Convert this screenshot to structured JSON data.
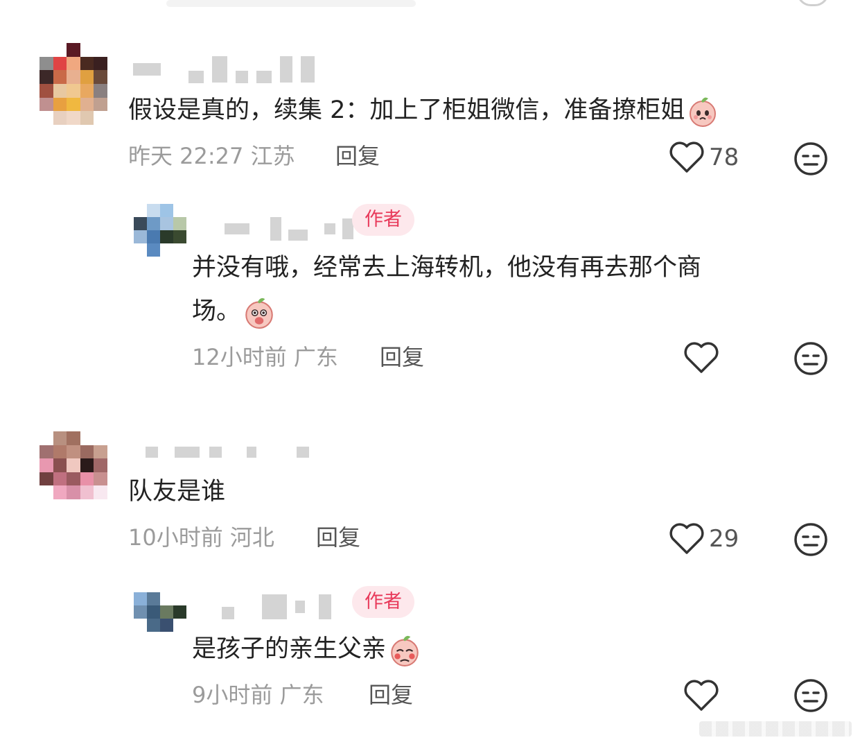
{
  "comments": [
    {
      "text": "假设是真的，续集 2：加上了柜姐微信，准备撩柜姐",
      "time": "昨天 22:27",
      "location": "江苏",
      "reply_label": "回复",
      "likes": "78",
      "avatar_colors": [
        "#ffffff",
        "#ffffff",
        "#5a1a24",
        "#ffffff",
        "#ffffff",
        "#8e8e8e",
        "#e04444",
        "#f0a880",
        "#4a2a20",
        "#3a2020",
        "#3c2828",
        "#c96a48",
        "#e8b090",
        "#e0a040",
        "#6a4a3a",
        "#a05040",
        "#e8c8a0",
        "#f0c890",
        "#e8a860",
        "#8a8080",
        "#c09090",
        "#e8a040",
        "#f0b840",
        "#e0b090",
        "#c0a090",
        "#ffffff",
        "#e8d0c0",
        "#f0d8c8",
        "#e0c8b0",
        "#ffffff"
      ],
      "reply": {
        "badge": "作者",
        "text_line1": "并没有哦，经常去上海转机，他没有再去那个商",
        "text_line2": "场。",
        "time": "12小时前",
        "location": "广东",
        "reply_label": "回复",
        "avatar_colors": [
          "#ffffff",
          "#c8dcef",
          "#9ec4e6",
          "#ffffff",
          "#3a4a5a",
          "#6e9ac6",
          "#a8c4e0",
          "#b8c8a8",
          "#9ab8d8",
          "#4a7ab0",
          "#2a3a2a",
          "#3a4a30",
          "#ffffff",
          "#5a8ac0",
          "#ffffff",
          "#ffffff"
        ]
      }
    },
    {
      "text": "队友是谁",
      "time": "10小时前",
      "location": "河北",
      "reply_label": "回复",
      "likes": "29",
      "avatar_colors": [
        "#ffffff",
        "#b89080",
        "#a07060",
        "#ffffff",
        "#ffffff",
        "#a07070",
        "#b07a6a",
        "#c09080",
        "#9a6a60",
        "#c8a090",
        "#e898b0",
        "#8a5050",
        "#f0c8c0",
        "#2a1a1a",
        "#a06868",
        "#704040",
        "#c07080",
        "#9a5a60",
        "#e890a8",
        "#c89090",
        "#ffffff",
        "#f0a8c0",
        "#d890a8",
        "#f0c0d0",
        "#f8e8f0"
      ],
      "reply": {
        "badge": "作者",
        "text": "是孩子的亲生父亲",
        "time": "9小时前",
        "location": "广东",
        "reply_label": "回复",
        "avatar_colors": [
          "#8ab0d8",
          "#5a7a98",
          "#ffffff",
          "#ffffff",
          "#7090b0",
          "#3a5a78",
          "#6a7a60",
          "#2a3a2a",
          "#ffffff",
          "#4a6a88",
          "#3a5070",
          "#ffffff"
        ]
      }
    }
  ],
  "colors": {
    "text": "#222222",
    "meta": "#9b9b9b",
    "author_badge_bg": "#fde8ec",
    "author_badge_text": "#e8395a",
    "icon": "#333333"
  },
  "icons": {
    "like": "heart-outline-icon",
    "dislike": "neutral-face-icon",
    "emoji": "peach-face-emoji"
  }
}
